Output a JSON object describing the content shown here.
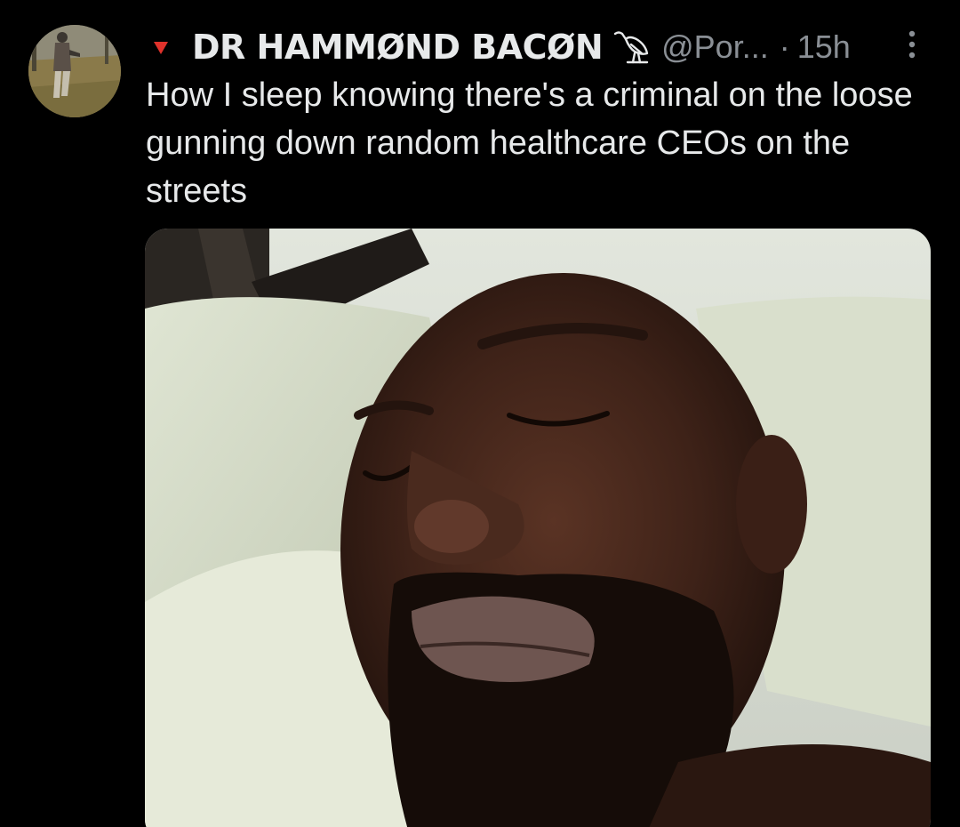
{
  "post": {
    "author": {
      "display_name": "DR HAMMØND BACØN",
      "handle": "@Por...",
      "avatar_icon": "avatar-photo",
      "flag_icon": "red-triangle-icon",
      "badge_icon": "ibis-bird-icon"
    },
    "separator": "·",
    "time": "15h",
    "menu_icon": "more-vertical-icon",
    "text": "How I sleep knowing there's a criminal on the loose gunning down random healthcare CEOs on the streets",
    "media": {
      "kind": "photo",
      "icon": "sleeping-man-photo"
    }
  },
  "colors": {
    "background": "#000000",
    "text_primary": "#e7e9ea",
    "text_secondary": "#8a8f95",
    "flag_red": "#e0322b"
  }
}
